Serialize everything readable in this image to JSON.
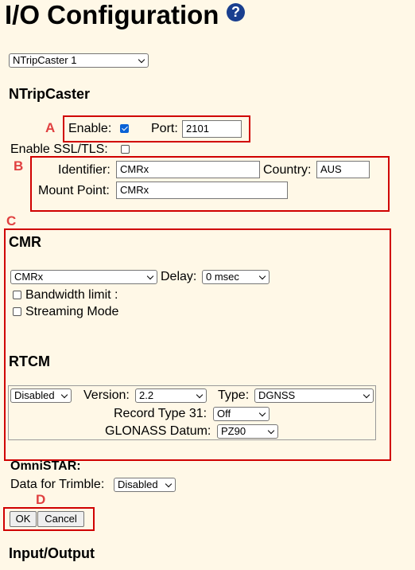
{
  "page": {
    "title": "I/O Configuration",
    "help_glyph": "?",
    "help_icon": "question-circle-icon",
    "port_select": "NTripCaster 1"
  },
  "ntrip": {
    "heading": "NTripCaster",
    "enable_label": "Enable:",
    "enable_checked": true,
    "port_label": "Port:",
    "port_value": "2101",
    "ssl_label": "Enable SSL/TLS:",
    "ssl_checked": false,
    "identifier_label": "Identifier:",
    "identifier_value": "CMRx",
    "country_label": "Country:",
    "country_value": "AUS",
    "mount_label": "Mount Point:",
    "mount_value": "CMRx"
  },
  "cmr": {
    "heading": "CMR",
    "type_select": "CMRx",
    "delay_label": "Delay:",
    "delay_select": "0 msec",
    "bandwidth_label": "Bandwidth limit :",
    "bandwidth_checked": false,
    "streaming_label": "Streaming Mode",
    "streaming_checked": false
  },
  "rtcm": {
    "heading": "RTCM",
    "enable_select": "Disabled",
    "version_label": "Version:",
    "version_select": "2.2",
    "type_label": "Type:",
    "type_select": "DGNSS",
    "record31_label": "Record Type 31:",
    "record31_select": "Off",
    "glonass_label": "GLONASS Datum:",
    "glonass_select": "PZ90"
  },
  "omnistar": {
    "heading": "OmniSTAR:",
    "trimble_label": "Data for Trimble:",
    "trimble_select": "Disabled"
  },
  "buttons": {
    "ok": "OK",
    "cancel": "Cancel"
  },
  "footer": {
    "heading": "Input/Output"
  },
  "annotations": {
    "a": "A",
    "b": "B",
    "c": "C",
    "d": "D",
    "color": "#d00000"
  },
  "colors": {
    "background": "#fff8e7",
    "checkbox_checked": "#0a62d6"
  }
}
